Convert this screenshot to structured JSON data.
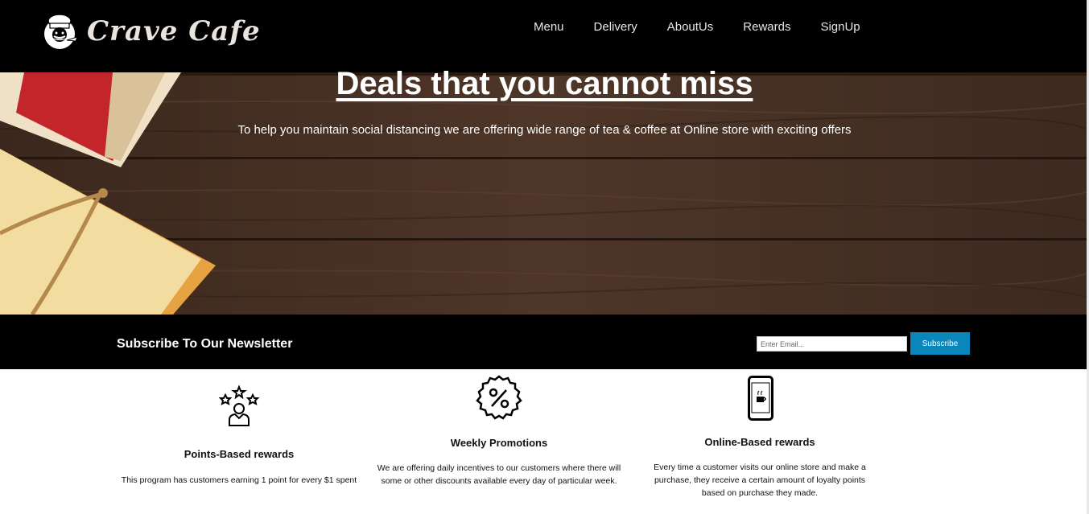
{
  "header": {
    "brand": "Crave Cafe",
    "nav": [
      "Menu",
      "Delivery",
      "AboutUs",
      "Rewards",
      "SignUp"
    ]
  },
  "hero": {
    "title": "Deals that you cannot miss",
    "subtitle": "To help you maintain social distancing we are offering wide range of tea & coffee at Online store with exciting offers"
  },
  "newsletter": {
    "title": "Subscribe To Our Newsletter",
    "email_placeholder": "Enter Email...",
    "button_label": "Subscribe",
    "button_color": "#0b86bb"
  },
  "features": [
    {
      "icon": "user-stars-icon",
      "title": "Points-Based rewards",
      "desc": "This program has customers earning 1 point for every $1 spent"
    },
    {
      "icon": "percent-badge-icon",
      "title": "Weekly Promotions",
      "desc": "We are offering daily incentives to our customers where there will some or other discounts available every day of particular week."
    },
    {
      "icon": "phone-coffee-icon",
      "title": "Online-Based rewards",
      "desc": "Every time a customer visits our online store and make a purchase, they receive a certain amount of loyalty points based on purchase they made."
    }
  ]
}
